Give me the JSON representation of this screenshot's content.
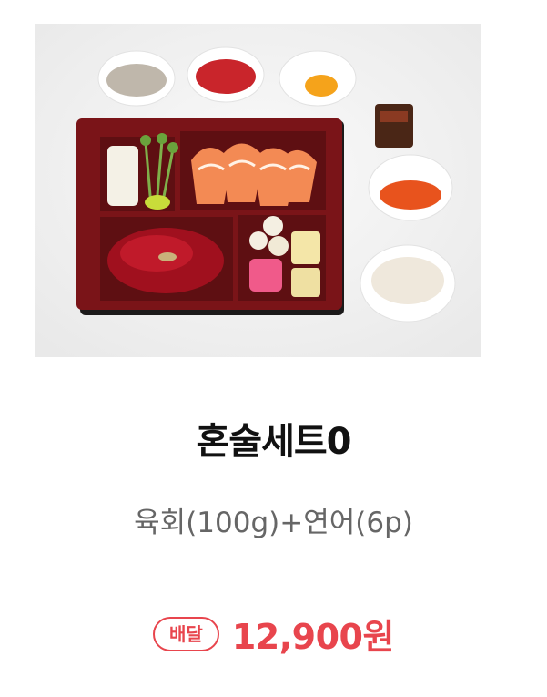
{
  "product": {
    "image_alt": "product photo",
    "name": "혼술세트0",
    "description": "육회(100g)+연어(6p)",
    "badge": "배달",
    "price": "12,900원"
  },
  "colors": {
    "accent": "#e8454d",
    "title": "#111111",
    "subtitle": "#666666"
  }
}
